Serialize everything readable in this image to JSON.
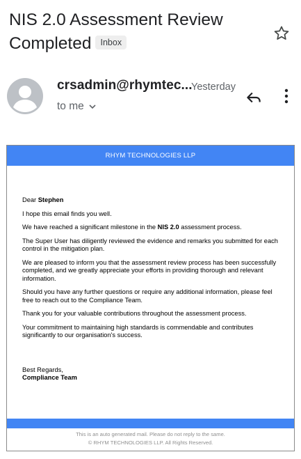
{
  "email": {
    "subject": "NIS 2.0 Assessment Review Completed",
    "label": "Inbox",
    "sender": "crsadmin@rhymtec...",
    "date": "Yesterday",
    "recipient": "to me"
  },
  "message": {
    "brand": "RHYM TECHNOLOGIES LLP",
    "greeting_prefix": "Dear ",
    "greeting_name": "Stephen",
    "p1": "I hope this email finds you well.",
    "p2_prefix": "We have reached a significant milestone in the ",
    "p2_bold": "NIS 2.0",
    "p2_suffix": " assessment process.",
    "p3": "The Super User has diligently reviewed the evidence and remarks you submitted for each control in the mitigation plan.",
    "p4": "We are pleased to inform you that the assessment review process has been successfully completed, and we greatly appreciate your efforts in providing thorough and relevant information.",
    "p5": "Should you have any further questions or require any additional information, please feel free to reach out to the Compliance Team.",
    "p6": "Thank you for your valuable contributions throughout the assessment process.",
    "p7": "Your commitment to maintaining high standards is commendable and contributes significantly to our organisation's success.",
    "signoff": "Best Regards,",
    "signature": "Compliance Team",
    "footer_line1": "This is an auto generated mail. Please do not reply to the same.",
    "footer_line2": "© RHYM TECHNOLOGIES LLP. All Rights Reserved."
  },
  "icons": {
    "star": "star-outline-icon",
    "avatar": "person-icon",
    "reply": "reply-icon",
    "more": "more-vert-icon",
    "chevron": "chevron-down-icon"
  },
  "colors": {
    "brand_blue": "#4285f4",
    "avatar_gray": "#bdc1c6"
  }
}
